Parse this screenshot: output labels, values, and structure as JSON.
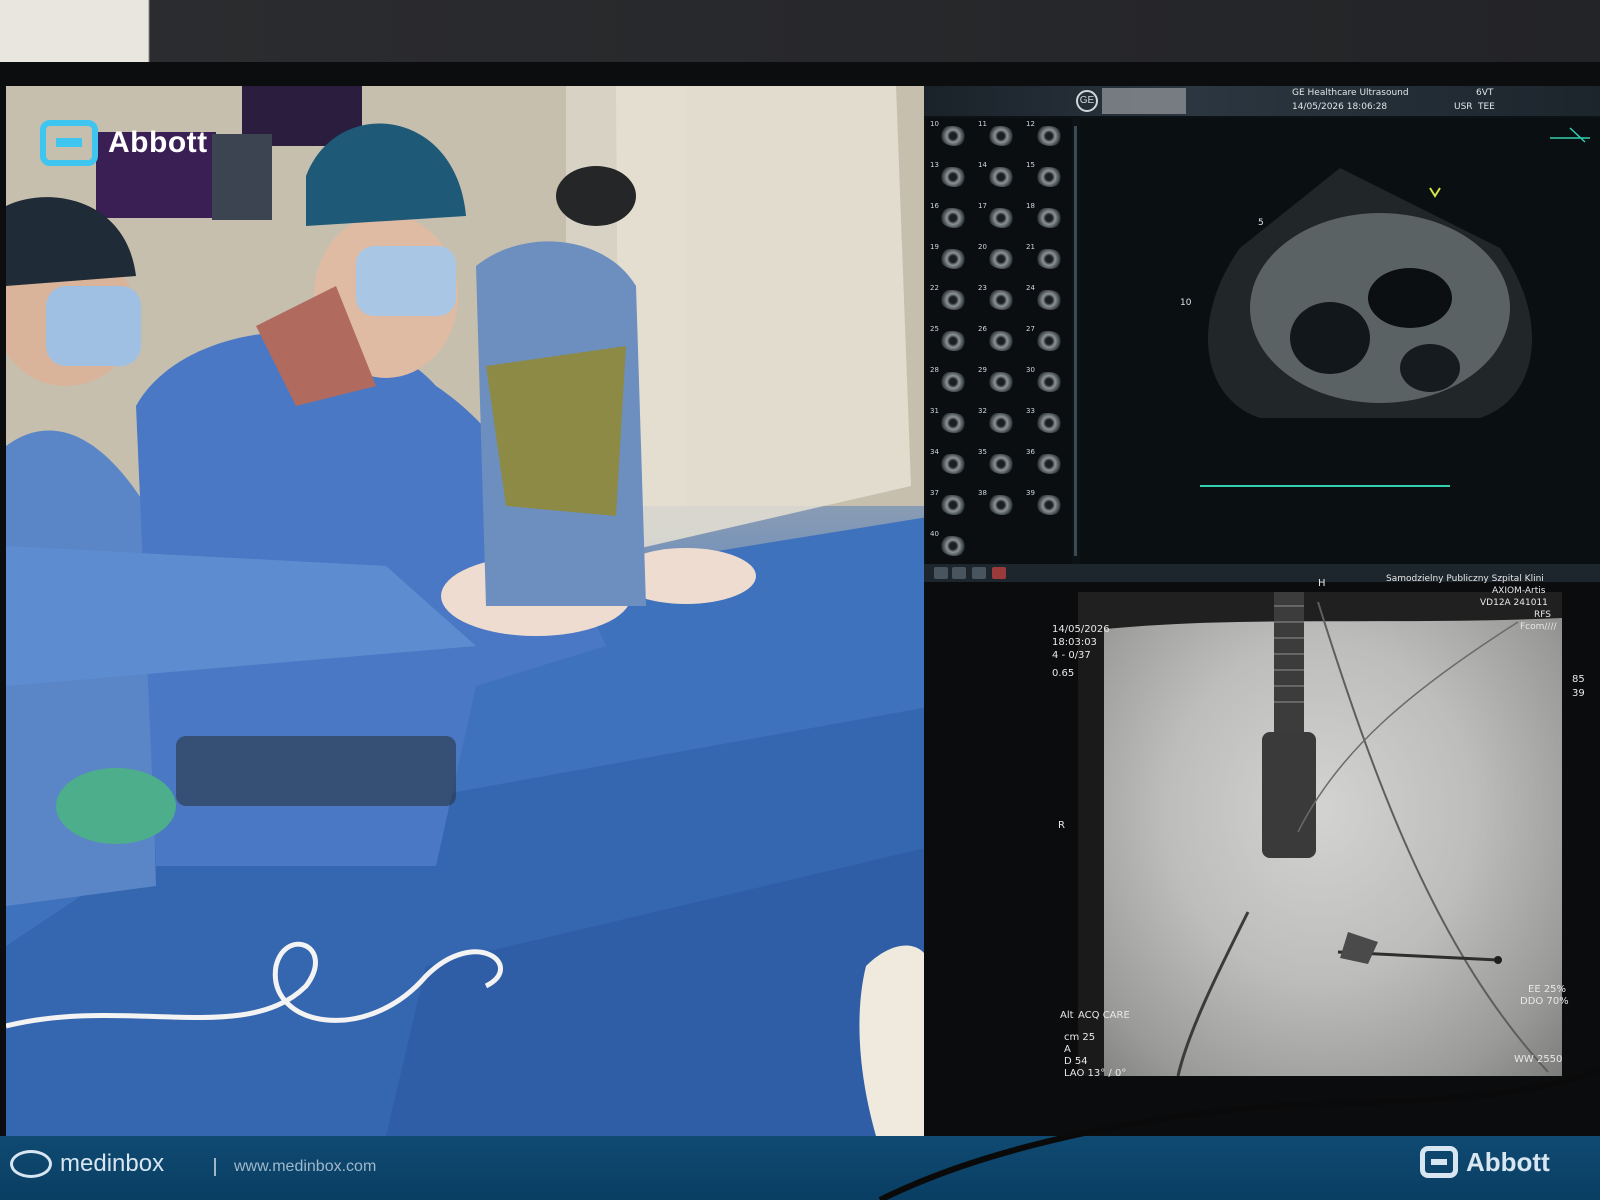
{
  "live_video": {
    "brand": "Abbott",
    "cap_text": "Abbott"
  },
  "ultrasound": {
    "vendor": "GE Healthcare Ultrasound",
    "datetime": "14/05/2026 18:06:28",
    "probe": "6VT",
    "mode": "TEE",
    "user": "USR",
    "depth_marks": [
      "5",
      "10"
    ],
    "thumbnail_numbers": [
      "10",
      "11",
      "12",
      "13",
      "14",
      "15",
      "16",
      "17",
      "18",
      "19",
      "20",
      "21",
      "22",
      "23",
      "24",
      "25",
      "26",
      "27",
      "28",
      "29",
      "30",
      "31",
      "32",
      "33",
      "34",
      "35",
      "36",
      "37",
      "38",
      "39",
      "40"
    ]
  },
  "fluoroscopy": {
    "date": "14/05/2026",
    "time": "18:03:03",
    "series": "4 - 0/37",
    "exposure": "0.65",
    "hospital_lines": [
      "Samodzielny Publiczny Szpital Klini",
      "AXIOM-Artis",
      "VD12A 241011",
      "RFS",
      "Fcom////"
    ],
    "orientation_top": "H",
    "orientation_left": "R",
    "acq_label": "ACQ CARE",
    "acq_prefix": "Alt",
    "params": [
      "cm 25",
      "A",
      "D 54",
      "LAO 13° / 0°"
    ],
    "edge_enhance": "EE 25%",
    "ddo": "DDO 70%",
    "ww": "WW 2550",
    "side_numbers": [
      "85",
      "39"
    ]
  },
  "footer": {
    "left_brand": "medinbox",
    "url": "www.medinbox.com",
    "right_brand": "Abbott"
  },
  "colors": {
    "abbott_blue": "#3ec5f0",
    "footer_bar": "#0f4a72",
    "us_background": "#0d1216"
  }
}
